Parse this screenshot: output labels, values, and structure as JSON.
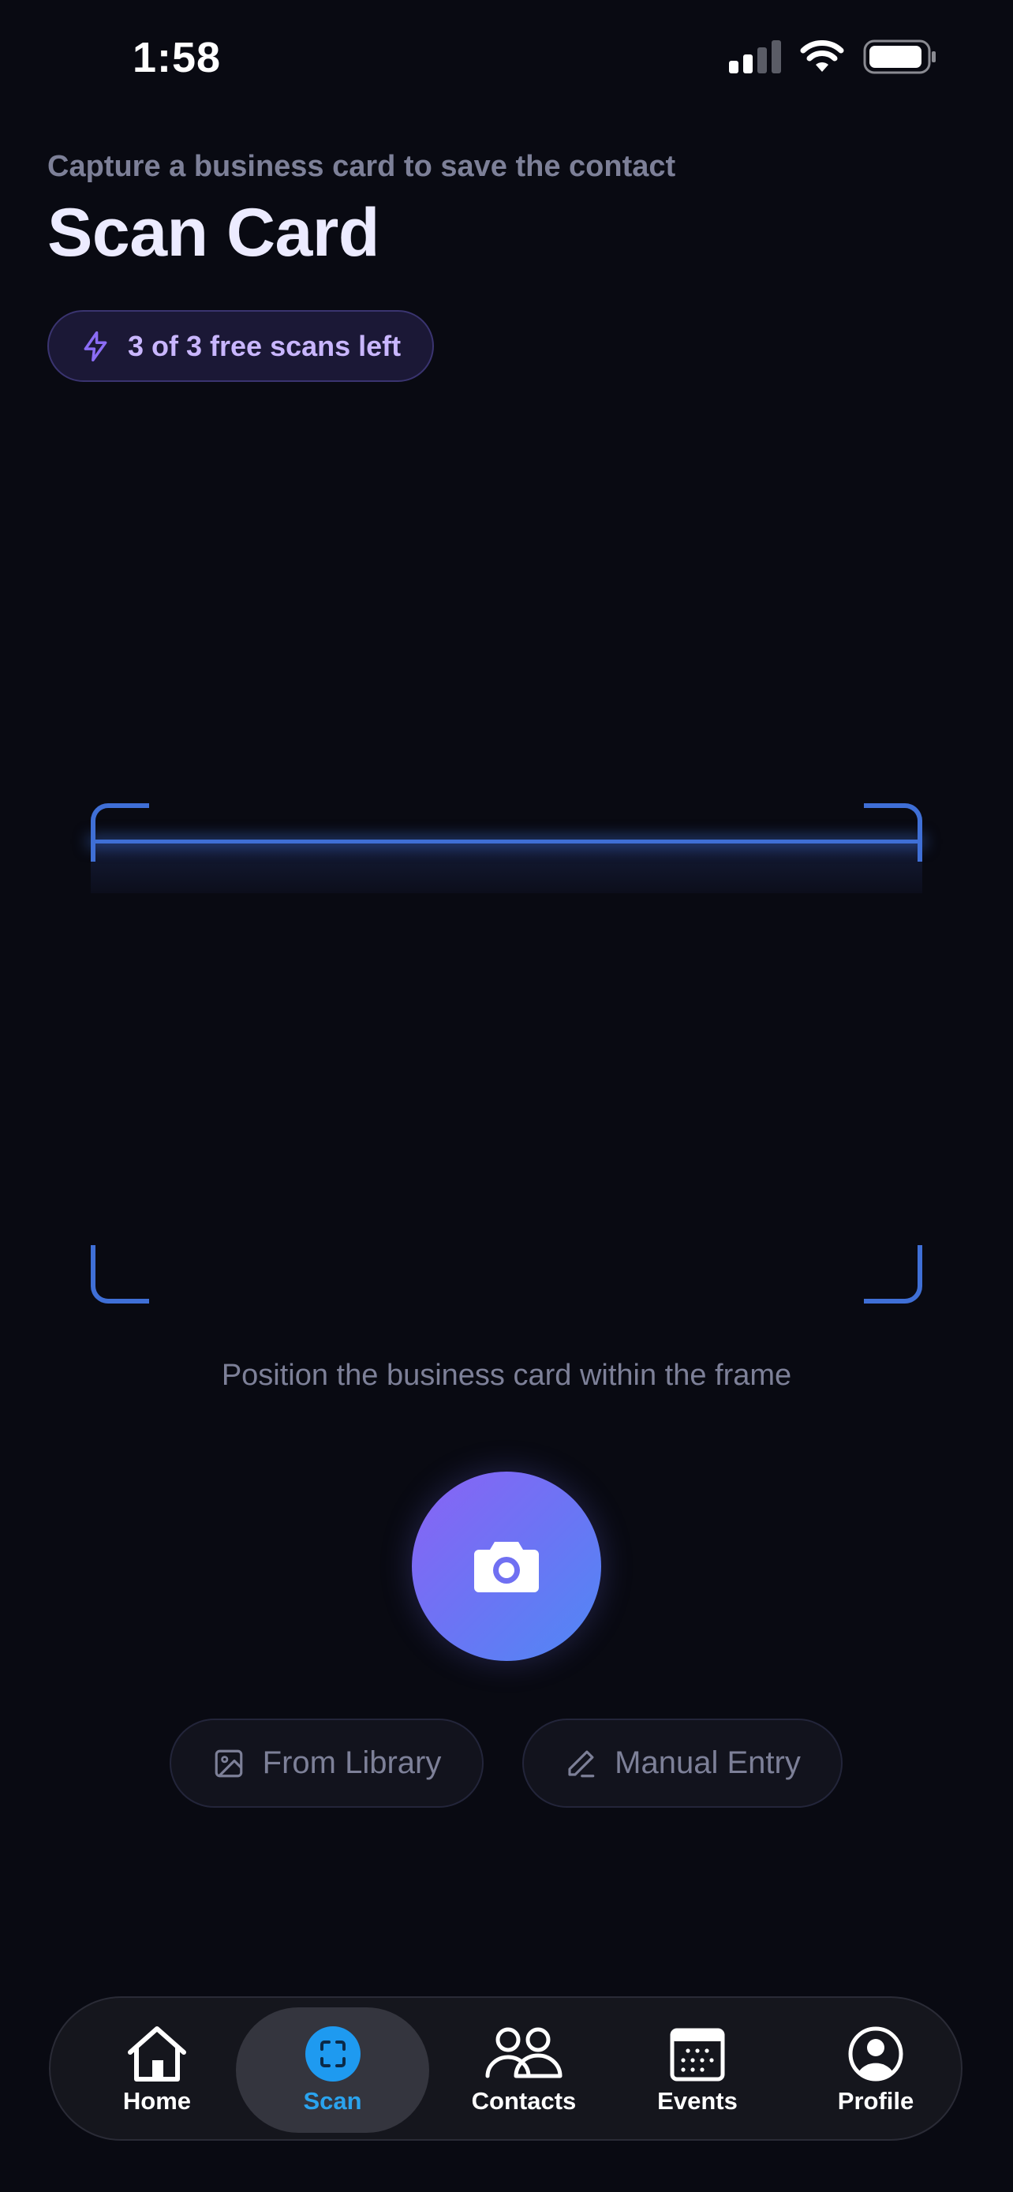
{
  "status_bar": {
    "time": "1:58"
  },
  "header": {
    "subtitle": "Capture a business card to save the contact",
    "title": "Scan Card"
  },
  "badge": {
    "text": "3 of 3 free scans left",
    "icon": "lightning-icon"
  },
  "scanner": {
    "hint": "Position the business card within the frame"
  },
  "capture_button": {
    "icon": "camera-icon"
  },
  "actions": {
    "library_label": "From Library",
    "library_icon": "image-icon",
    "manual_label": "Manual Entry",
    "manual_icon": "pencil-icon"
  },
  "tabbar": {
    "items": [
      {
        "label": "Home",
        "icon": "home-icon"
      },
      {
        "label": "Scan",
        "icon": "scan-icon",
        "active": true
      },
      {
        "label": "Contacts",
        "icon": "users-icon"
      },
      {
        "label": "Events",
        "icon": "calendar-icon"
      },
      {
        "label": "Profile",
        "icon": "user-circle-icon"
      }
    ]
  },
  "colors": {
    "background": "#090a12",
    "accent_purple": "#8a63f5",
    "accent_blue": "#4f88f5",
    "scan_frame": "#3f6fd6",
    "active_tab": "#2aa3ee"
  }
}
